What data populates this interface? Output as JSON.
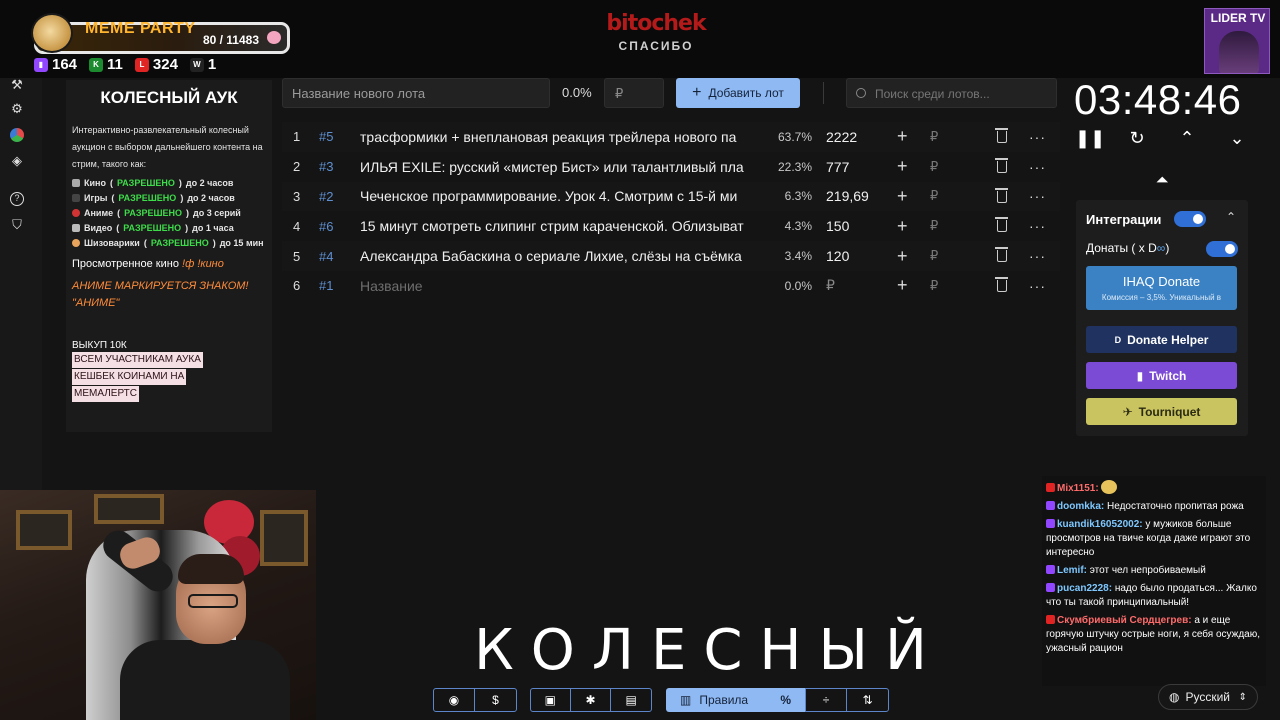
{
  "overlay": {
    "logo_text": "bitochek",
    "logo_sub": "СПАСИБО",
    "meme_title": "MEME PARTY",
    "meme_count": "80 / 11483",
    "stats": [
      {
        "icon": "twitch-icon",
        "value": "164",
        "color": "#9146ff"
      },
      {
        "icon": "kick-icon",
        "value": "11",
        "color": "#53fc18"
      },
      {
        "icon": "vk-live-icon",
        "value": "324",
        "color": "#e02424"
      },
      {
        "icon": "w-icon",
        "value": "1",
        "color": "#ffffff"
      }
    ],
    "lider_text": "LIDER TV",
    "big_word": "КОЛЕСНЫЙ"
  },
  "left_panel": {
    "title": "КОЛЕСНЫЙ АУК",
    "description": "Интерактивно-развлекательный колесный аукцион с выбором дальнейшего контента на стрим, такого как:",
    "items": [
      {
        "name": "Кино",
        "status": "РАЗРЕШЕНО",
        "limit": "до 2 часов",
        "color": "#aaaaaa"
      },
      {
        "name": "Игры",
        "status": "РАЗРЕШЕНО",
        "limit": "до 2 часов",
        "color": "#333333"
      },
      {
        "name": "Аниме",
        "status": "РАЗРЕШЕНО",
        "limit": "до 3 серий",
        "color": "#d23434"
      },
      {
        "name": "Видео",
        "status": "РАЗРЕШЕНО",
        "limit": "до 1 часа",
        "color": "#bbbbbb"
      },
      {
        "name": "Шизоварики",
        "status": "РАЗРЕШЕНО",
        "limit": "до 15 мин",
        "color": "#e8a35c"
      }
    ],
    "movie_prefix": "Просмотренное кино",
    "movie_cmd": "!ф !кино",
    "anime_note": "АНИМЕ МАРКИРУЕТСЯ ЗНАКОМ! \"АНИМЕ\"",
    "buyout": "ВЫКУП 10К",
    "highlight_lines": [
      "ВСЕМ УЧАСТНИКАМ АУКА",
      "КЕШБЕК КОИНАМИ НА",
      "МЕМАЛЕРТС"
    ]
  },
  "toolbar": {
    "lot_placeholder": "Название нового лота",
    "percent": "0.0%",
    "currency_placeholder": "₽",
    "add_label": "Добавить лот",
    "search_placeholder": "Поиск среди лотов..."
  },
  "lots": [
    {
      "num": "1",
      "id": "#5",
      "name": "трасформики + внеплановая реакция трейлера нового па",
      "pct": "63.7%",
      "amount": "2222"
    },
    {
      "num": "2",
      "id": "#3",
      "name": "ИЛЬЯ EXILE: русский «мистер Бист» или талантливый пла",
      "pct": "22.3%",
      "amount": "777"
    },
    {
      "num": "3",
      "id": "#2",
      "name": "Чеченское программирование. Урок 4. Смотрим с 15-й ми",
      "pct": "6.3%",
      "amount": "219,69"
    },
    {
      "num": "4",
      "id": "#6",
      "name": "15 минут смотреть слипинг стрим караченской. Облизыват",
      "pct": "4.3%",
      "amount": "150"
    },
    {
      "num": "5",
      "id": "#4",
      "name": "Александра Бабаскина о сериале Лихие, слёзы на съёмка",
      "pct": "3.4%",
      "amount": "120"
    },
    {
      "num": "6",
      "id": "#1",
      "name": "Название",
      "pct": "0.0%",
      "amount": "₽"
    }
  ],
  "row_symbols": {
    "plus": "+",
    "rub": "₽",
    "more": "···"
  },
  "timer": {
    "value": "03:48:46"
  },
  "integrations": {
    "title": "Интеграции",
    "donations_label": "Донаты ( x D",
    "donations_suffix": ")",
    "ihaq_title": "IHAQ Donate",
    "ihaq_sub": "Комиссия – 3,5%. Уникальный в",
    "buttons": [
      {
        "label": "Donate Helper",
        "color": "#1f3260"
      },
      {
        "label": "Twitch",
        "color": "#7c4bd6"
      },
      {
        "label": "Tourniquet",
        "color": "#c9c460"
      }
    ]
  },
  "chat": [
    {
      "user": "Mix1151:",
      "text": "",
      "color": "#ff6b6b"
    },
    {
      "user": "doomkka:",
      "text": "Недостаточно пропитая рожа",
      "color": "#7ec8ff"
    },
    {
      "user": "kuandik16052002:",
      "text": "у мужиков больше просмотров на твиче когда даже играют это интересно",
      "color": "#7ec8ff"
    },
    {
      "user": "Lemif:",
      "text": "этот чел непробиваемый",
      "color": "#7ec8ff"
    },
    {
      "user": "pucan2228:",
      "text": "надо было продаться... Жалко что ты такой принципиальный!",
      "color": "#7ec8ff"
    },
    {
      "user": "Скумбриевый Сердцегрев:",
      "text": "а и еще горячую штучку острые ноги, я себя осуждаю, ужасный рацион",
      "color": "#ff6b6b"
    }
  ],
  "bottom": {
    "rules_label": "Правила",
    "percent_symbol": "%",
    "language": "Русский"
  }
}
